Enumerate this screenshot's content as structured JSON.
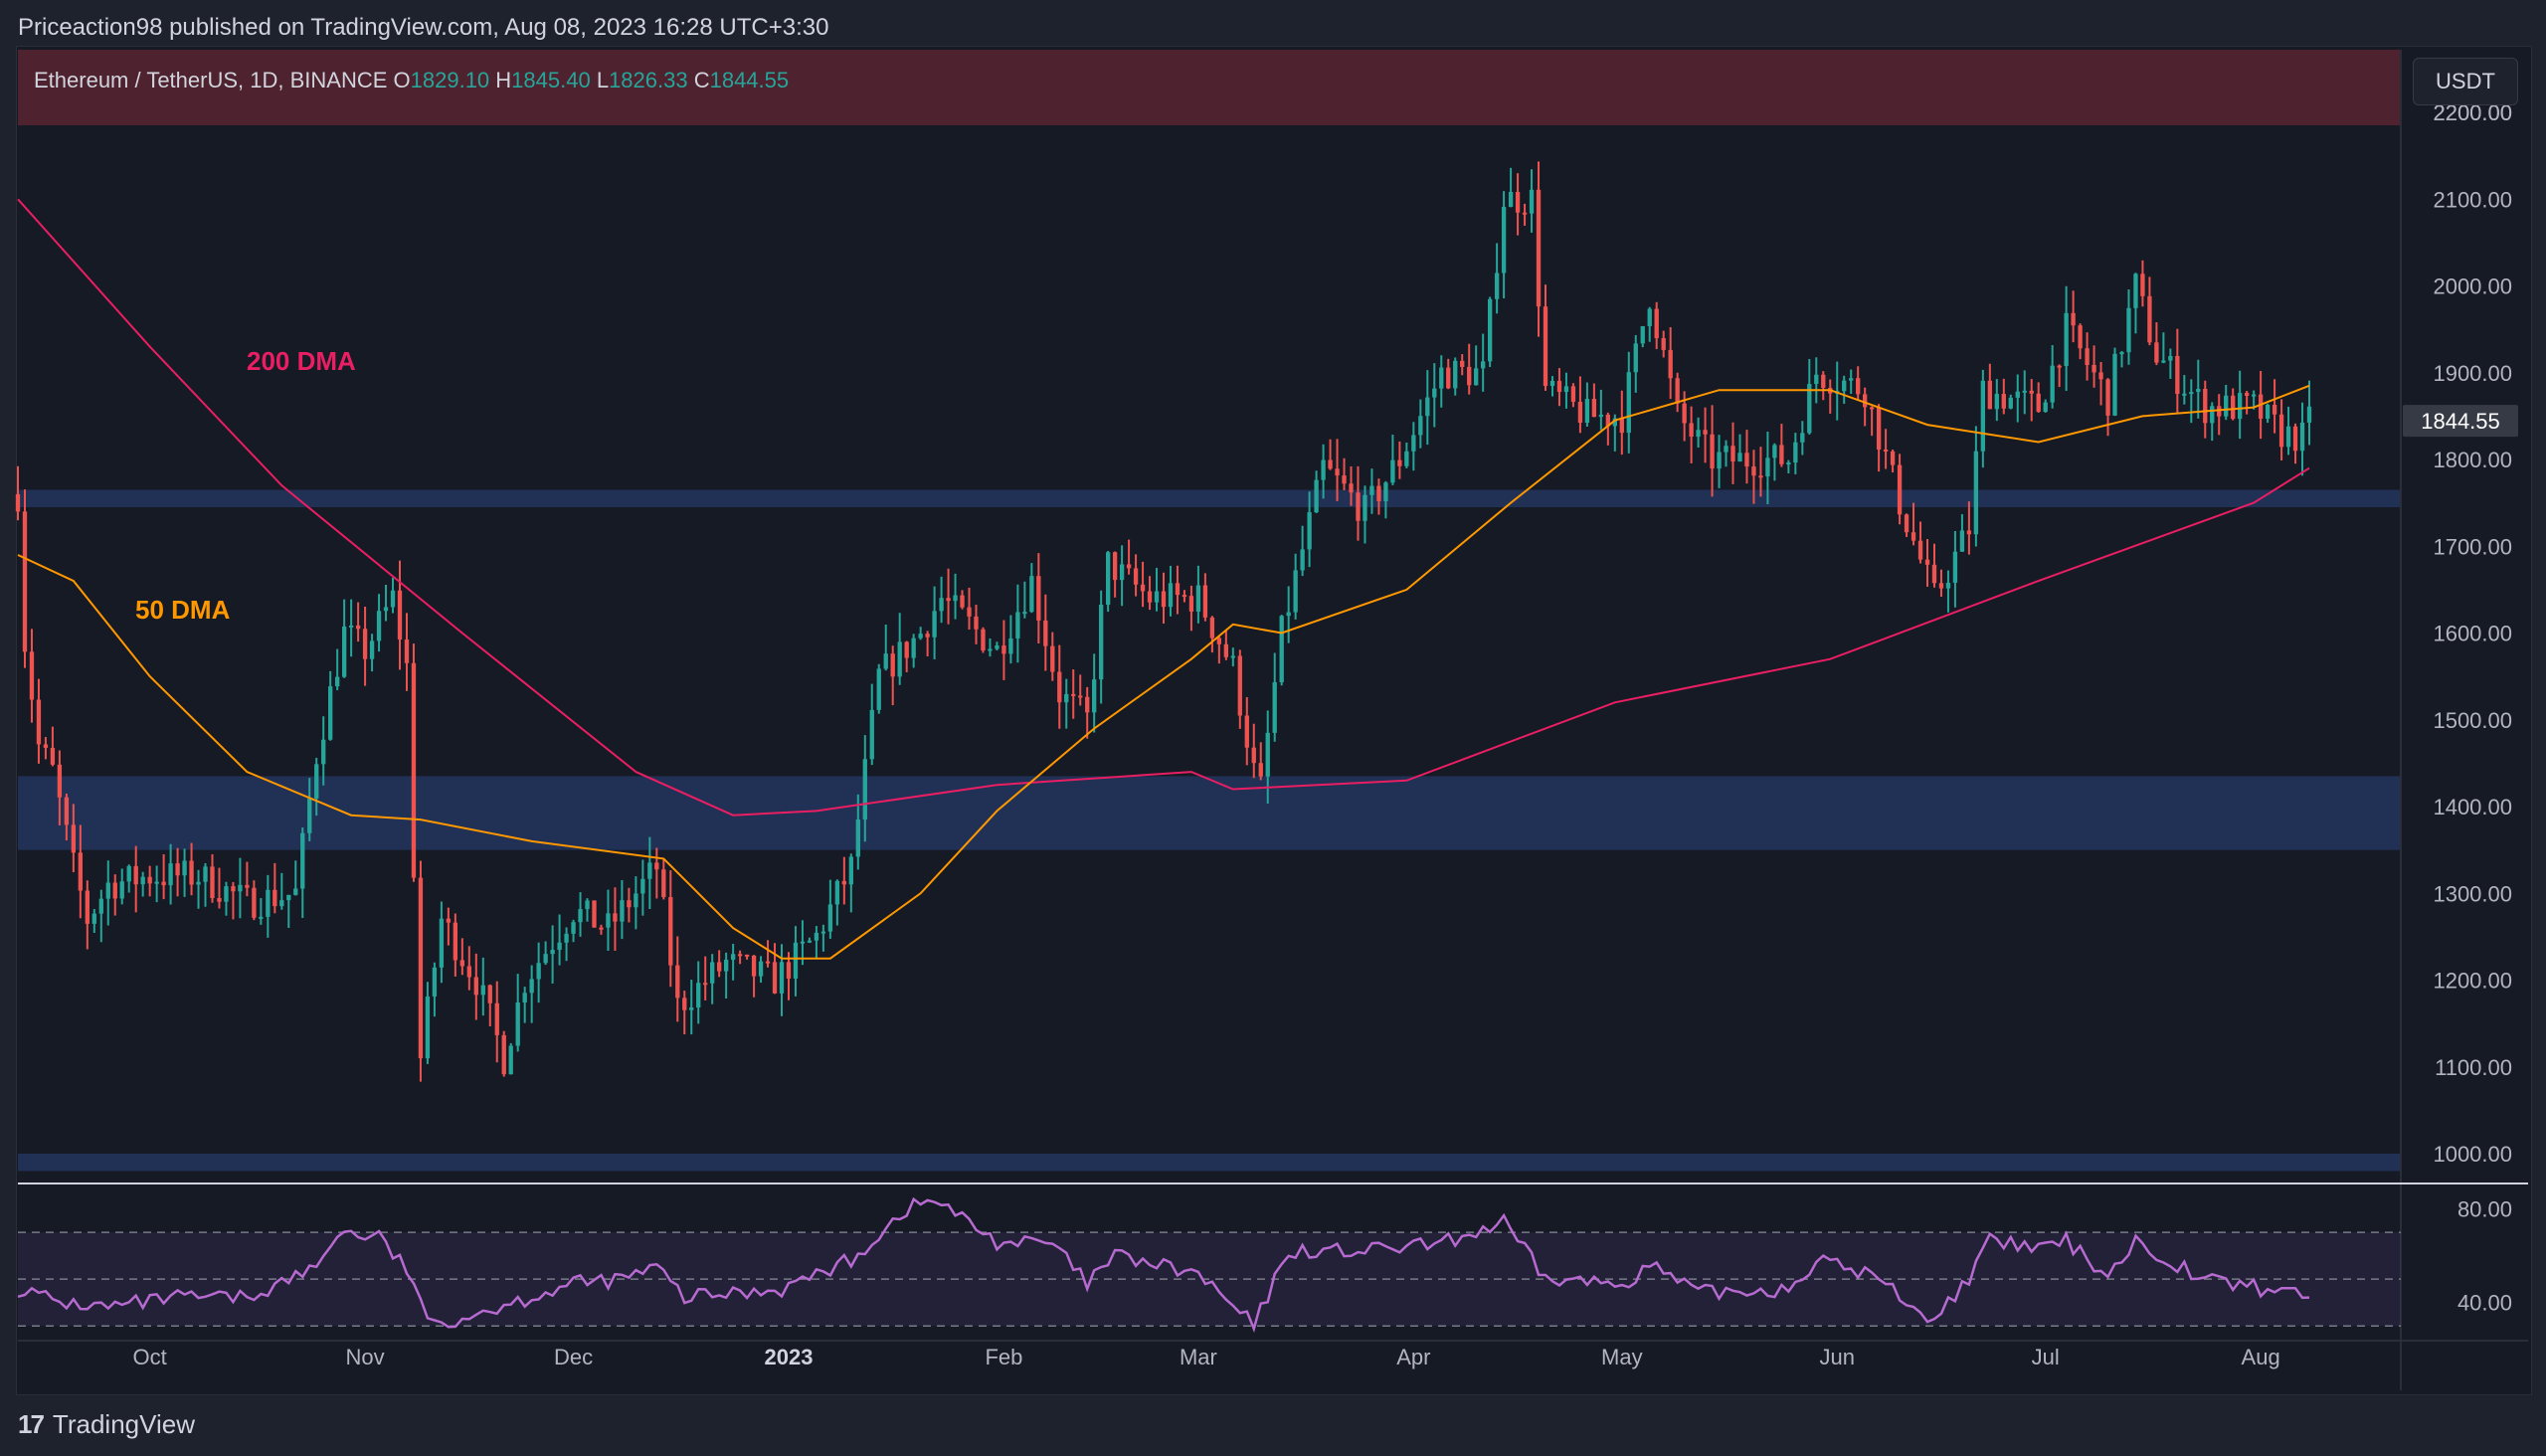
{
  "header": {
    "publisher_line": "Priceaction98 published on TradingView.com, Aug 08, 2023 16:28 UTC+3:30"
  },
  "legend": {
    "symbol": "Ethereum / TetherUS, 1D, BINANCE",
    "open_label": "O",
    "open": "1829.10",
    "high_label": "H",
    "high": "1845.40",
    "low_label": "L",
    "low": "1826.33",
    "close_label": "C",
    "close": "1844.55"
  },
  "currency_button": "USDT",
  "annotations": {
    "dma200": "200 DMA",
    "dma50": "50 DMA"
  },
  "price_badge": "1844.55",
  "footer": {
    "logo": "17",
    "brand": "TradingView"
  },
  "colors": {
    "background": "#161a25",
    "up": "#26a69a",
    "down": "#ef5350",
    "dma200": "#e91e63",
    "dma50": "#ff9800",
    "zone": "#253a66",
    "rsi": "#b76ad0",
    "header_band": "#4e222e"
  },
  "chart_data": {
    "type": "candlestick",
    "title": "Ethereum / TetherUS, 1D, BINANCE",
    "price_axis": {
      "min": 1000,
      "max": 2200,
      "ticks": [
        1000,
        1100,
        1200,
        1300,
        1400,
        1500,
        1600,
        1700,
        1800,
        1900,
        2000,
        2100,
        2200
      ],
      "tick_labels": [
        "1000.00",
        "1100.00",
        "1200.00",
        "1300.00",
        "1400.00",
        "1500.00",
        "1600.00",
        "1700.00",
        "1800.00",
        "1900.00",
        "2000.00",
        "2100.00",
        "2200.00"
      ]
    },
    "time_axis": {
      "start": "2022-09-12",
      "end": "2023-08-08",
      "ticks": [
        {
          "label": "Oct",
          "date": "2022-10-01"
        },
        {
          "label": "Nov",
          "date": "2022-11-01"
        },
        {
          "label": "Dec",
          "date": "2022-12-01"
        },
        {
          "label": "2023",
          "date": "2023-01-01",
          "bold": true
        },
        {
          "label": "Feb",
          "date": "2023-02-01"
        },
        {
          "label": "Mar",
          "date": "2023-03-01"
        },
        {
          "label": "Apr",
          "date": "2023-04-01"
        },
        {
          "label": "May",
          "date": "2023-05-01"
        },
        {
          "label": "Jun",
          "date": "2023-06-01"
        },
        {
          "label": "Jul",
          "date": "2023-07-01"
        },
        {
          "label": "Aug",
          "date": "2023-08-01"
        }
      ]
    },
    "zones": [
      {
        "from": 1745,
        "to": 1765
      },
      {
        "from": 1350,
        "to": 1435
      },
      {
        "from": 980,
        "to": 1000
      }
    ],
    "price_path": [
      [
        "2022-09-12",
        1760
      ],
      [
        "2022-09-13",
        1590
      ],
      [
        "2022-09-15",
        1470
      ],
      [
        "2022-09-17",
        1440
      ],
      [
        "2022-09-20",
        1330
      ],
      [
        "2022-09-22",
        1270
      ],
      [
        "2022-09-25",
        1310
      ],
      [
        "2022-10-01",
        1320
      ],
      [
        "2022-10-08",
        1320
      ],
      [
        "2022-10-15",
        1290
      ],
      [
        "2022-10-22",
        1300
      ],
      [
        "2022-10-25",
        1460
      ],
      [
        "2022-10-29",
        1600
      ],
      [
        "2022-11-01",
        1580
      ],
      [
        "2022-11-05",
        1640
      ],
      [
        "2022-11-07",
        1560
      ],
      [
        "2022-11-08",
        1330
      ],
      [
        "2022-11-09",
        1110
      ],
      [
        "2022-11-12",
        1270
      ],
      [
        "2022-11-17",
        1200
      ],
      [
        "2022-11-21",
        1110
      ],
      [
        "2022-11-24",
        1200
      ],
      [
        "2022-12-01",
        1280
      ],
      [
        "2022-12-06",
        1260
      ],
      [
        "2022-12-13",
        1330
      ],
      [
        "2022-12-16",
        1170
      ],
      [
        "2022-12-23",
        1220
      ],
      [
        "2022-12-30",
        1200
      ],
      [
        "2023-01-05",
        1250
      ],
      [
        "2023-01-10",
        1330
      ],
      [
        "2023-01-14",
        1550
      ],
      [
        "2023-01-20",
        1600
      ],
      [
        "2023-01-23",
        1640
      ],
      [
        "2023-01-31",
        1580
      ],
      [
        "2023-02-05",
        1660
      ],
      [
        "2023-02-09",
        1530
      ],
      [
        "2023-02-13",
        1500
      ],
      [
        "2023-02-16",
        1680
      ],
      [
        "2023-02-22",
        1640
      ],
      [
        "2023-03-01",
        1640
      ],
      [
        "2023-03-06",
        1560
      ],
      [
        "2023-03-09",
        1440
      ],
      [
        "2023-03-10",
        1420
      ],
      [
        "2023-03-13",
        1600
      ],
      [
        "2023-03-19",
        1790
      ],
      [
        "2023-03-25",
        1740
      ],
      [
        "2023-03-30",
        1800
      ],
      [
        "2023-04-05",
        1900
      ],
      [
        "2023-04-11",
        1900
      ],
      [
        "2023-04-14",
        2100
      ],
      [
        "2023-04-18",
        2100
      ],
      [
        "2023-04-20",
        1880
      ],
      [
        "2023-04-26",
        1850
      ],
      [
        "2023-05-01",
        1850
      ],
      [
        "2023-05-05",
        1990
      ],
      [
        "2023-05-09",
        1850
      ],
      [
        "2023-05-14",
        1800
      ],
      [
        "2023-05-25",
        1800
      ],
      [
        "2023-05-29",
        1900
      ],
      [
        "2023-06-05",
        1880
      ],
      [
        "2023-06-10",
        1750
      ],
      [
        "2023-06-15",
        1640
      ],
      [
        "2023-06-20",
        1720
      ],
      [
        "2023-06-22",
        1880
      ],
      [
        "2023-06-30",
        1860
      ],
      [
        "2023-07-04",
        1950
      ],
      [
        "2023-07-10",
        1870
      ],
      [
        "2023-07-14",
        2000
      ],
      [
        "2023-07-17",
        1920
      ],
      [
        "2023-07-24",
        1860
      ],
      [
        "2023-07-31",
        1860
      ],
      [
        "2023-08-04",
        1830
      ],
      [
        "2023-08-07",
        1825
      ],
      [
        "2023-08-08",
        1844.55
      ]
    ],
    "dma50": [
      [
        "2022-09-12",
        1690
      ],
      [
        "2022-09-20",
        1660
      ],
      [
        "2022-10-01",
        1550
      ],
      [
        "2022-10-15",
        1440
      ],
      [
        "2022-10-30",
        1390
      ],
      [
        "2022-11-09",
        1385
      ],
      [
        "2022-11-25",
        1360
      ],
      [
        "2022-12-14",
        1340
      ],
      [
        "2022-12-24",
        1260
      ],
      [
        "2022-12-31",
        1225
      ],
      [
        "2023-01-07",
        1225
      ],
      [
        "2023-01-20",
        1300
      ],
      [
        "2023-01-31",
        1395
      ],
      [
        "2023-02-14",
        1490
      ],
      [
        "2023-02-28",
        1570
      ],
      [
        "2023-03-06",
        1610
      ],
      [
        "2023-03-13",
        1600
      ],
      [
        "2023-03-31",
        1650
      ],
      [
        "2023-04-15",
        1750
      ],
      [
        "2023-04-30",
        1845
      ],
      [
        "2023-05-15",
        1880
      ],
      [
        "2023-05-31",
        1880
      ],
      [
        "2023-06-14",
        1840
      ],
      [
        "2023-06-30",
        1820
      ],
      [
        "2023-07-15",
        1850
      ],
      [
        "2023-07-31",
        1860
      ],
      [
        "2023-08-08",
        1885
      ]
    ],
    "dma200": [
      [
        "2022-09-12",
        2100
      ],
      [
        "2022-10-01",
        1930
      ],
      [
        "2022-10-20",
        1770
      ],
      [
        "2022-11-15",
        1600
      ],
      [
        "2022-12-10",
        1440
      ],
      [
        "2022-12-24",
        1390
      ],
      [
        "2023-01-05",
        1395
      ],
      [
        "2023-01-31",
        1425
      ],
      [
        "2023-02-28",
        1440
      ],
      [
        "2023-03-06",
        1420
      ],
      [
        "2023-03-31",
        1430
      ],
      [
        "2023-04-30",
        1520
      ],
      [
        "2023-05-31",
        1570
      ],
      [
        "2023-06-30",
        1660
      ],
      [
        "2023-07-31",
        1750
      ],
      [
        "2023-08-08",
        1790
      ]
    ],
    "rsi": {
      "ticks": [
        40,
        80
      ],
      "tick_labels": [
        "40.00",
        "80.00"
      ],
      "levels": [
        30,
        50,
        70
      ],
      "range": [
        25,
        90
      ],
      "values": [
        [
          "2022-09-12",
          46
        ],
        [
          "2022-09-18",
          40
        ],
        [
          "2022-09-25",
          38
        ],
        [
          "2022-10-05",
          42
        ],
        [
          "2022-10-15",
          42
        ],
        [
          "2022-10-25",
          55
        ],
        [
          "2022-10-28",
          70
        ],
        [
          "2022-11-03",
          68
        ],
        [
          "2022-11-08",
          50
        ],
        [
          "2022-11-10",
          30
        ],
        [
          "2022-11-20",
          38
        ],
        [
          "2022-12-01",
          48
        ],
        [
          "2022-12-08",
          50
        ],
        [
          "2022-12-13",
          55
        ],
        [
          "2022-12-17",
          42
        ],
        [
          "2022-12-31",
          46
        ],
        [
          "2023-01-10",
          58
        ],
        [
          "2023-01-18",
          80
        ],
        [
          "2023-01-22",
          84
        ],
        [
          "2023-01-31",
          66
        ],
        [
          "2023-02-08",
          65
        ],
        [
          "2023-02-13",
          48
        ],
        [
          "2023-02-17",
          60
        ],
        [
          "2023-03-01",
          52
        ],
        [
          "2023-03-09",
          30
        ],
        [
          "2023-03-14",
          62
        ],
        [
          "2023-03-25",
          62
        ],
        [
          "2023-04-05",
          65
        ],
        [
          "2023-04-14",
          74
        ],
        [
          "2023-04-20",
          50
        ],
        [
          "2023-05-01",
          48
        ],
        [
          "2023-05-05",
          56
        ],
        [
          "2023-05-12",
          44
        ],
        [
          "2023-05-25",
          46
        ],
        [
          "2023-05-29",
          58
        ],
        [
          "2023-06-06",
          52
        ],
        [
          "2023-06-15",
          32
        ],
        [
          "2023-06-21",
          55
        ],
        [
          "2023-06-23",
          66
        ],
        [
          "2023-06-30",
          63
        ],
        [
          "2023-07-04",
          66
        ],
        [
          "2023-07-10",
          52
        ],
        [
          "2023-07-14",
          66
        ],
        [
          "2023-07-24",
          50
        ],
        [
          "2023-08-01",
          46
        ],
        [
          "2023-08-08",
          44
        ]
      ]
    }
  }
}
